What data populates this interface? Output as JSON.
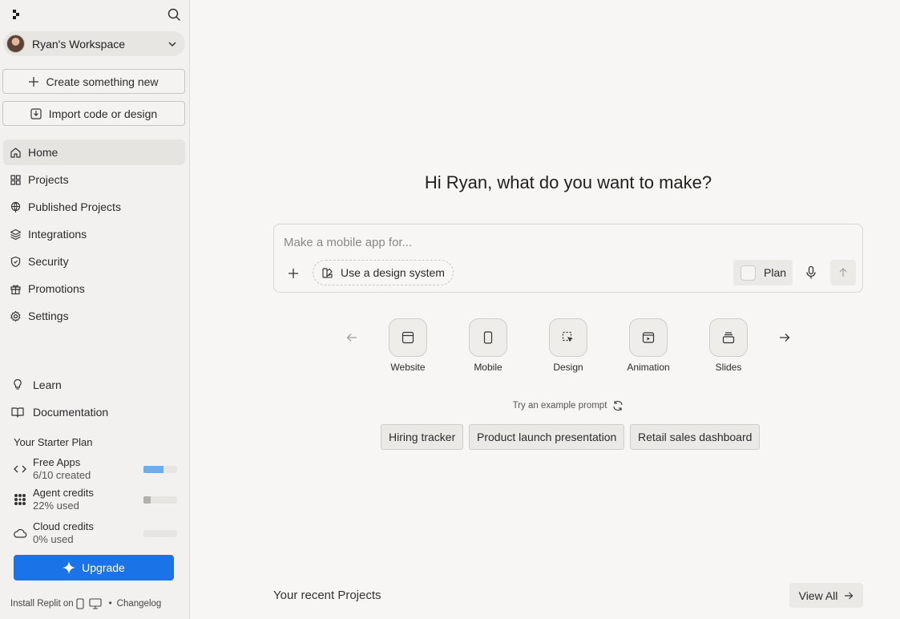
{
  "sidebar": {
    "workspace_name": "Ryan's Workspace",
    "create_label": "Create something new",
    "import_label": "Import code or design",
    "nav": [
      {
        "label": "Home",
        "icon": "home-icon"
      },
      {
        "label": "Projects",
        "icon": "grid-icon"
      },
      {
        "label": "Published Projects",
        "icon": "globe-icon"
      },
      {
        "label": "Integrations",
        "icon": "layers-icon"
      },
      {
        "label": "Security",
        "icon": "shield-icon"
      },
      {
        "label": "Promotions",
        "icon": "gift-icon"
      },
      {
        "label": "Settings",
        "icon": "gear-icon"
      }
    ],
    "learn_label": "Learn",
    "docs_label": "Documentation",
    "plan_title": "Your Starter Plan",
    "usage": [
      {
        "label": "Free Apps",
        "sub": "6/10 created",
        "fraction": 0.6,
        "color": "#6aaef0"
      },
      {
        "label": "Agent credits",
        "sub": "22% used",
        "fraction": 0.22,
        "color": "#b3b1ae"
      },
      {
        "label": "Cloud credits",
        "sub": "0% used",
        "fraction": 0.0,
        "color": "#b3b1ae"
      }
    ],
    "upgrade_label": "Upgrade",
    "install_label": "Install Replit on",
    "changelog_label": "Changelog"
  },
  "main": {
    "greeting": "Hi Ryan, what do you want to make?",
    "prompt_placeholder": "Make a mobile app for...",
    "design_system_label": "Use a design system",
    "plan_label": "Plan",
    "categories": [
      {
        "label": "Website",
        "icon": "browser-window-icon"
      },
      {
        "label": "Mobile",
        "icon": "phone-icon"
      },
      {
        "label": "Design",
        "icon": "select-cursor-icon"
      },
      {
        "label": "Animation",
        "icon": "play-frame-icon"
      },
      {
        "label": "Slides",
        "icon": "stacked-slides-icon"
      }
    ],
    "try_label": "Try an example prompt",
    "example_prompts": [
      "Hiring tracker",
      "Product launch presentation",
      "Retail sales dashboard"
    ],
    "recent_title": "Your recent Projects",
    "view_all_label": "View All"
  },
  "colors": {
    "accent": "#1b73e8",
    "background": "#f7f6f4",
    "sidebar": "#f2f1ef"
  }
}
